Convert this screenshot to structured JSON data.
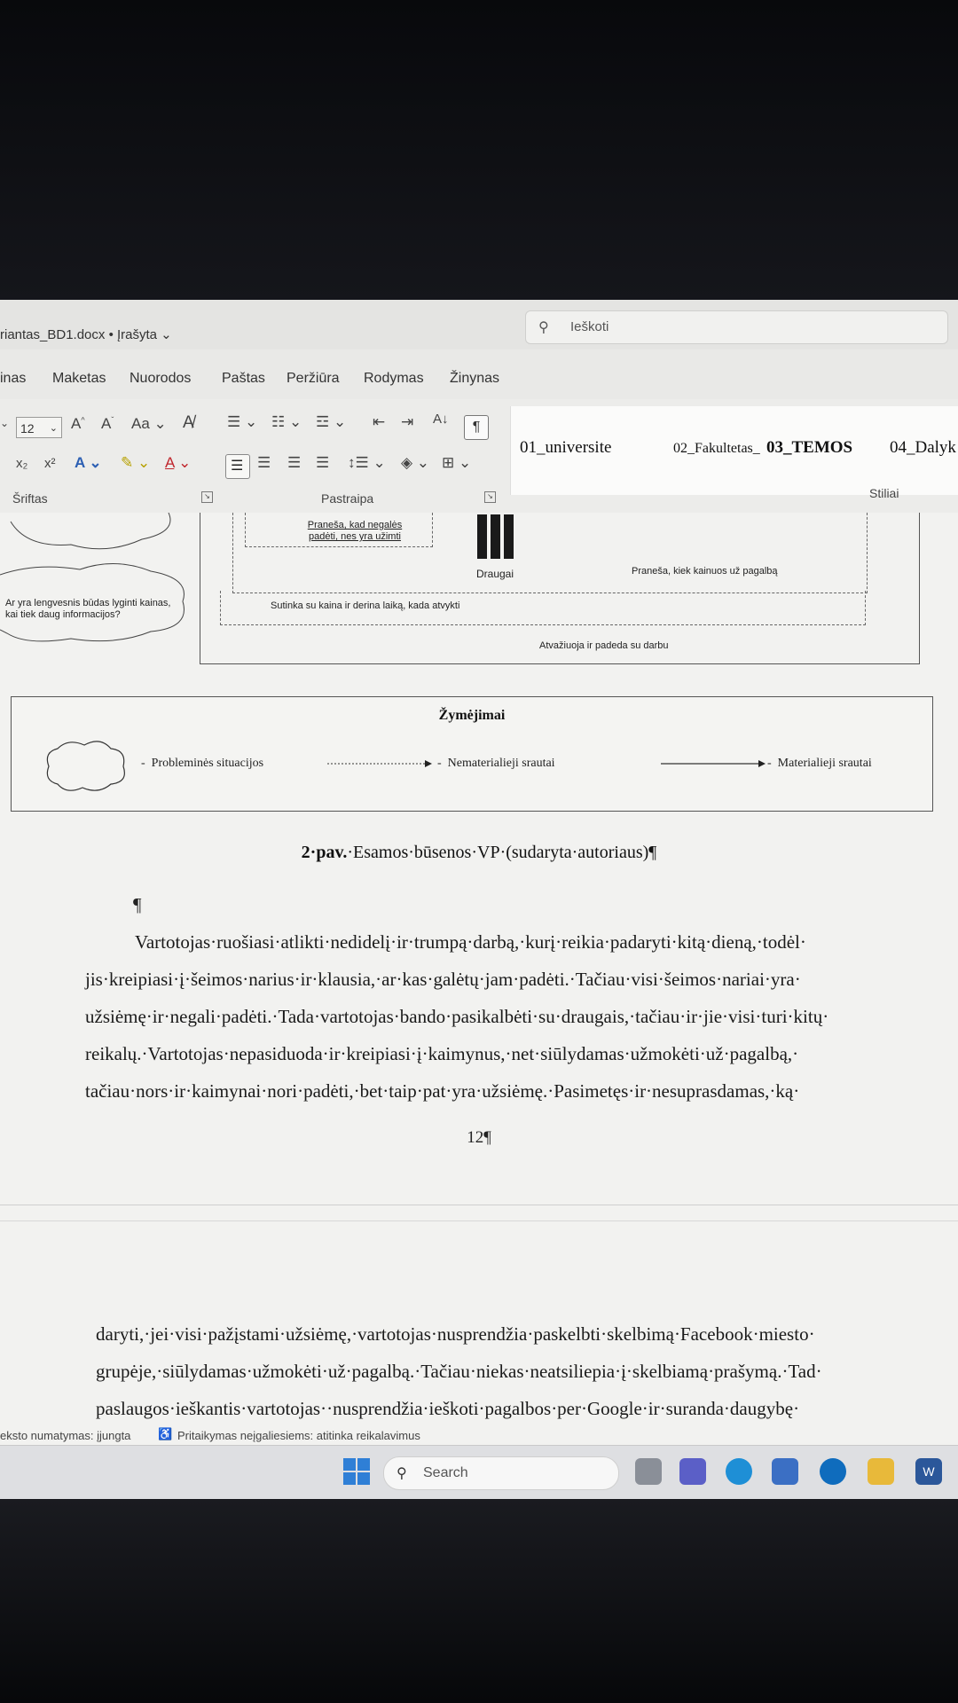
{
  "titlebar": {
    "doc_title": "riantas_BD1.docx • Įrašyta ⌄",
    "search_placeholder": "Ieškoti"
  },
  "menu": {
    "items": [
      "inas",
      "Maketas",
      "Nuorodos",
      "Paštas",
      "Peržiūra",
      "Rodymas",
      "Žinynas"
    ]
  },
  "ribbon": {
    "font_size": "12",
    "group_font": "Šriftas",
    "group_paragraph": "Pastraipa",
    "group_styles": "Stiliai",
    "styles": [
      "01_universite",
      "02_Fakultetas_",
      "03_TEMOS",
      "04_Dalyk"
    ]
  },
  "diagram": {
    "box_text": "Praneša, kad negalės padėti, nes yra užimti",
    "friends": "Draugai",
    "price_note": "Praneša, kiek kainuos už pagalbą",
    "agree": "Sutinka su kaina ir derina laiką, kada atvykti",
    "arrives": "Atvažiuoja ir padeda su darbu",
    "cloud_question": "Ar yra lengvesnis būdas lyginti kainas, kai tiek daug informacijos?"
  },
  "legend": {
    "title": "Žymėjimai",
    "items": [
      "Probleminės situacijos",
      "Nematerialieji srautai",
      "Materialieji srautai"
    ]
  },
  "document": {
    "caption_bold": "2·pav.",
    "caption_rest": "·Esamos·būsenos·VP·(sudaryta·autoriaus)¶",
    "empty_paragraph": "¶",
    "lines": [
      "Vartotojas·ruošiasi·atlikti·nedidelį·ir·trumpą·darbą,·kurį·reikia·padaryti·kitą·dieną,·todėl·",
      "jis·kreipiasi·į·šeimos·narius·ir·klausia,·ar·kas·galėtų·jam·padėti.·Tačiau·visi·šeimos·nariai·yra·",
      "užsiėmę·ir·negali·padėti.·Tada·vartotojas·bando·pasikalbėti·su·draugais,·tačiau·ir·jie·visi·turi·kitų·",
      "reikalų.·Vartotojas·nepasiduoda·ir·kreipiasi·į·kaimynus,·net·siūlydamas·užmokėti·už·pagalbą,·",
      "tačiau·nors·ir·kaimynai·nori·padėti,·bet·taip·pat·yra·užsiėmę.·Pasimetęs·ir·nesuprasdamas,·ką·"
    ],
    "page_number": "12¶",
    "page2_lines": [
      "daryti,·jei·visi·pažįstami·užsiėmę,·vartotojas·nusprendžia·paskelbti·skelbimą·Facebook·miesto·",
      "grupėje,·siūlydamas·užmokėti·už·pagalbą.·Tačiau·niekas·neatsiliepia·į·skelbiamą·prašymą.·Tad·",
      "paslaugos·ieškantis·vartotojas··nusprendžia·ieškoti·pagalbos·per·Google·ir·suranda·daugybę·"
    ]
  },
  "status": {
    "text_prediction": "eksto numatymas: įjungta",
    "accessibility": "Pritaikymas neįgaliesiems: atitinka reikalavimus"
  },
  "taskbar": {
    "search_label": "Search"
  }
}
